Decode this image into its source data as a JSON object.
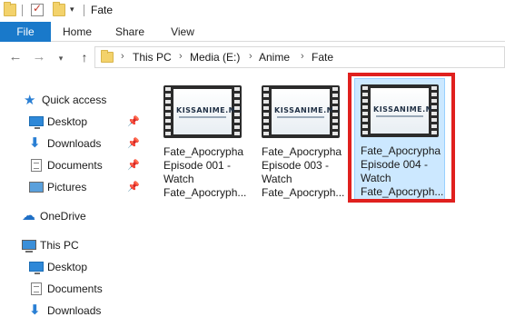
{
  "window": {
    "title": "Fate"
  },
  "ribbon": {
    "tabs": [
      "File",
      "Home",
      "Share",
      "View"
    ]
  },
  "address": {
    "crumbs": [
      "This PC",
      "Media (E:)",
      "Anime",
      "Fate"
    ]
  },
  "navpane": {
    "quick_access": "Quick access",
    "quick_items": [
      "Desktop",
      "Downloads",
      "Documents",
      "Pictures"
    ],
    "onedrive": "OneDrive",
    "this_pc": "This PC",
    "pc_items": [
      "Desktop",
      "Documents",
      "Downloads"
    ]
  },
  "files": [
    {
      "name": "Fate_Apocrypha Episode 001 - Watch Fate_Apocryph...",
      "thumb_brand": "KISSANIME.ME"
    },
    {
      "name": "Fate_Apocrypha Episode 003 - Watch Fate_Apocryph...",
      "thumb_brand": "KISSANIME.ME"
    },
    {
      "name": "Fate_Apocrypha Episode 004 - Watch Fate_Apocryph...",
      "thumb_brand": "KISSANIME.ME",
      "selected": true
    }
  ],
  "colors": {
    "accent": "#1979ca",
    "selection": "#cce8ff",
    "highlight": "#e0201e"
  },
  "icons": [
    "folder-icon",
    "properties-icon",
    "back-arrow-icon",
    "forward-arrow-icon",
    "up-arrow-icon",
    "star-icon",
    "pin-icon",
    "monitor-icon",
    "download-icon",
    "document-icon",
    "picture-icon",
    "cloud-icon",
    "computer-icon",
    "video-thumbnail-icon"
  ]
}
